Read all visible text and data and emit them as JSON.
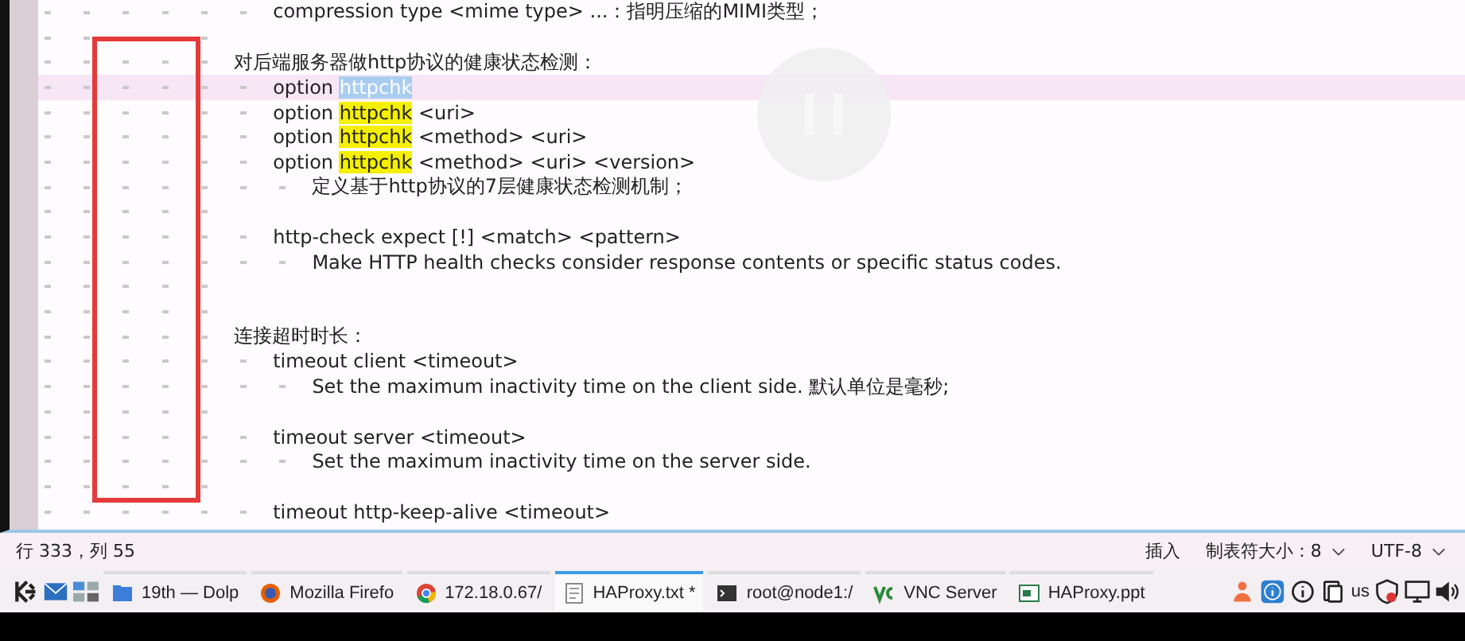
{
  "editor": {
    "lines": [
      {
        "kind": "directive",
        "current": false,
        "parts": [
          {
            "kind": "plain",
            "text": "compression type <mime type> ...：指明压缩的MIMI类型；"
          }
        ]
      },
      {
        "kind": "blank",
        "current": false
      },
      {
        "kind": "heading",
        "current": false,
        "parts": [
          {
            "kind": "plain",
            "text": "对后端服务器做http协议的健康状态检测："
          }
        ]
      },
      {
        "kind": "directive",
        "current": true,
        "parts": [
          {
            "kind": "plain",
            "text": "option "
          },
          {
            "kind": "selection",
            "text": "httpchk"
          }
        ]
      },
      {
        "kind": "directive",
        "current": false,
        "parts": [
          {
            "kind": "plain",
            "text": "option "
          },
          {
            "kind": "match",
            "text": "httpchk"
          },
          {
            "kind": "plain",
            "text": " <uri>"
          }
        ]
      },
      {
        "kind": "directive",
        "current": false,
        "parts": [
          {
            "kind": "plain",
            "text": "option "
          },
          {
            "kind": "match",
            "text": "httpchk"
          },
          {
            "kind": "plain",
            "text": " <method> <uri>"
          }
        ]
      },
      {
        "kind": "directive",
        "current": false,
        "parts": [
          {
            "kind": "plain",
            "text": "option "
          },
          {
            "kind": "match",
            "text": "httpchk"
          },
          {
            "kind": "plain",
            "text": " <method> <uri> <version>"
          }
        ]
      },
      {
        "kind": "note",
        "current": false,
        "parts": [
          {
            "kind": "plain",
            "text": "定义基于http协议的7层健康状态检测机制；"
          }
        ]
      },
      {
        "kind": "blank",
        "current": false
      },
      {
        "kind": "directive",
        "current": false,
        "parts": [
          {
            "kind": "plain",
            "text": "http-check expect [!] <match> <pattern>"
          }
        ]
      },
      {
        "kind": "note",
        "current": false,
        "parts": [
          {
            "kind": "plain",
            "text": "Make HTTP health checks consider response contents or specific status codes."
          }
        ]
      },
      {
        "kind": "blank",
        "current": false
      },
      {
        "kind": "blank",
        "current": false
      },
      {
        "kind": "heading",
        "current": false,
        "parts": [
          {
            "kind": "plain",
            "text": "连接超时时长："
          }
        ]
      },
      {
        "kind": "directive",
        "current": false,
        "parts": [
          {
            "kind": "plain",
            "text": "timeout client <timeout>"
          }
        ]
      },
      {
        "kind": "note",
        "current": false,
        "parts": [
          {
            "kind": "plain",
            "text": "Set the maximum inactivity time on the client side. 默认单位是毫秒;"
          }
        ]
      },
      {
        "kind": "blank",
        "current": false
      },
      {
        "kind": "directive",
        "current": false,
        "parts": [
          {
            "kind": "plain",
            "text": "timeout server <timeout>"
          }
        ]
      },
      {
        "kind": "note",
        "current": false,
        "parts": [
          {
            "kind": "plain",
            "text": "Set the maximum inactivity time on the server side."
          }
        ]
      },
      {
        "kind": "blank",
        "current": false
      },
      {
        "kind": "directive",
        "current": false,
        "parts": [
          {
            "kind": "plain",
            "text": "timeout http-keep-alive <timeout>"
          }
        ]
      }
    ]
  },
  "status_bar": {
    "position": "行 333，列 55",
    "mode": "插入",
    "tab_size": "制表符大小：8",
    "encoding": "UTF-8"
  },
  "taskbar": {
    "tasks": [
      {
        "kind": "folder",
        "label": "19th — Dolp",
        "selected": false
      },
      {
        "kind": "firefox",
        "label": "Mozilla Firefo",
        "selected": false
      },
      {
        "kind": "chrome",
        "label": "172.18.0.67/",
        "selected": false
      },
      {
        "kind": "text",
        "label": "HAProxy.txt *",
        "selected": true
      },
      {
        "kind": "terminal",
        "label": "root@node1:/",
        "selected": false
      },
      {
        "kind": "vnc",
        "label": "VNC Server",
        "selected": false
      },
      {
        "kind": "slides",
        "label": "HAProxy.ppt",
        "selected": false
      }
    ],
    "keyboard_layout": "us"
  }
}
